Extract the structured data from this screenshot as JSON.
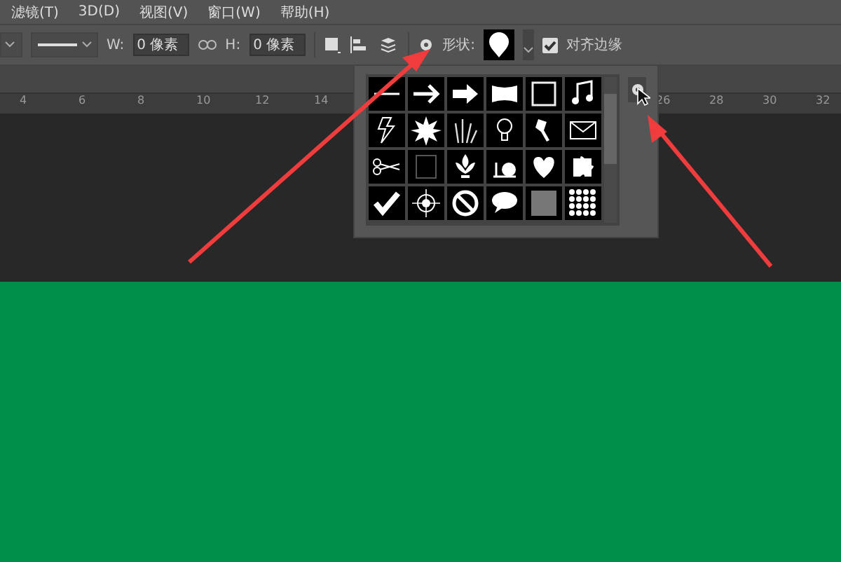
{
  "menu_bar": [
    "滤镜(T)",
    "3D(D)",
    "视图(V)",
    "窗口(W)",
    "帮助(H)"
  ],
  "options_bar": {
    "width_label": "W:",
    "width_value": "0 像素",
    "height_label": "H:",
    "height_value": "0 像素",
    "shape_label": "形状:",
    "align_edges": {
      "label": "对齐边缘",
      "checked": true
    }
  },
  "ruler": {
    "left_ticks": [
      "4",
      "6",
      "8",
      "10",
      "12",
      "14"
    ],
    "right_ticks": [
      "26",
      "28",
      "30",
      "32"
    ]
  },
  "shape_picker": {
    "open": true
  }
}
